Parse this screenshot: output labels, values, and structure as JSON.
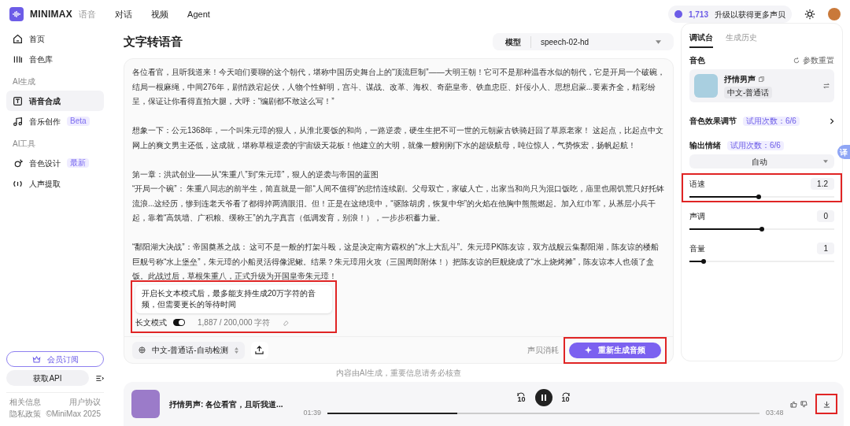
{
  "header": {
    "brand": "MINIMAX",
    "product": "语音",
    "nav": [
      {
        "label": "对话",
        "selected": false
      },
      {
        "label": "视频",
        "selected": false
      },
      {
        "label": "Agent",
        "selected": false
      }
    ],
    "credits": "1,713",
    "upgrade": "升级以获得更多声贝"
  },
  "sidebar": {
    "sections": [
      {
        "items": [
          {
            "label": "首页",
            "selected": false
          },
          {
            "label": "音色库",
            "selected": false
          }
        ]
      },
      {
        "title": "AI生成",
        "items": [
          {
            "label": "语音合成",
            "selected": true
          },
          {
            "label": "音乐创作",
            "badge": "Beta",
            "selected": false
          }
        ]
      },
      {
        "title": "AI工具",
        "items": [
          {
            "label": "音色设计",
            "badge": "最新",
            "selected": false
          },
          {
            "label": "人声提取",
            "selected": false
          }
        ]
      }
    ],
    "subscribe": "会员订阅",
    "api": "获取API",
    "footer": [
      [
        "相关信息",
        "用户协议"
      ],
      [
        "隐私政策",
        "©MiniMax 2025"
      ]
    ]
  },
  "page_title": "文字转语音",
  "model": {
    "label": "模型",
    "value": "speech-02-hd"
  },
  "editor": {
    "highlighted": true,
    "paragraphs": [
      {
        "text": "各位看官，且听我道来！今天咱们要聊的这个朝代，堪称中国历史舞台上的“顶流巨制”——大明王朝！它可不是那种温吞水似的朝代，它是开局一个破碗，结局一根麻绳，中间276年，剧情跌宕起伏，人物个性鲜明，宫斗、谋战、改革、海权、奇葩皇帝、铁血忠臣、奸佞小人、思想启蒙...要素齐全，精彩纷呈，保证让你看得直拍大腿，大呼：“编剧都不敢这么写！”",
        "blank_line_before": false
      },
      {
        "text": "想象一下：公元1368年，一个叫朱元璋的狠人，从淮北要饭的和尚，一路逆袭，硬生生把不可一世的元朝蒙古铁骑赶回了草原老家！ 这起点，比起点中文网上的爽文男主还低，这成就，堪称草根逆袭的宇宙级天花板！他建立的大明，就像一艘刚刚下水的超级航母，吨位惊人，气势恢宏，扬帆起航！",
        "blank_line_before": true
      },
      {
        "text": "第一章：洪武创业——从“朱重八”到“朱元璋”，狠人的逆袭与帝国的蓝图",
        "blank_line_before": true
      },
      {
        "text": "“开局一个碗”： 朱重八同志的前半生，简直就是一部“人间不值得”的悲情连续剧。父母双亡，家破人亡，出家当和尚只为混口饭吃，庙里也闹饥荒只好托钵流浪...这经历，惨到连老天爷看了都得掉两滴眼泪。但！正是在这绝境中，“驱除胡虏，恢复中华”的火焰在他胸中熊熊燃起。加入红巾军，从基层小兵干起，靠着“高筑墙、广积粮、缓称王”的九字真言（低调发育，别浪！），一步步积蓄力量。",
        "blank_line_before": false
      },
      {
        "text": "“鄱阳湖大决战”：帝国奠基之战： 这可不是一般的打架斗殴，这是决定南方霸权的“水上大乱斗”。朱元璋PK陈友谅，双方战舰云集鄱阳湖，陈友谅的楼船巨舰号称“水上堡垒”，朱元璋的小船灵活得像泥鳅。结果？朱元璋用火攻（三国周郎附体！）把陈友谅的巨舰烧成了“水上烧烤摊”，陈友谅本人也领了盒饭。此战过后，草根朱重八，正式升级为开国皇帝朱元璋！",
        "blank_line_before": true
      }
    ],
    "tooltip": "开启长文本模式后，最多能支持生成20万字符的音频，但需要更长的等待时间",
    "long_mode": {
      "label": "长文模式",
      "on": true
    },
    "count": "1,887 / 200,000 字符",
    "language": "中文-普通话-自动检测",
    "cost": "声贝消耗",
    "generate": {
      "label": "重新生成音频",
      "highlighted": true
    }
  },
  "disclaimer": "内容由AI生成，重要信息请务必核查",
  "panel": {
    "tabs": [
      {
        "label": "调试台",
        "selected": true
      },
      {
        "label": "生成历史",
        "selected": false
      }
    ],
    "voice_label": "音色",
    "reset": "参数重置",
    "voice": {
      "name": "抒情男声",
      "tag": "中文-普通话"
    },
    "effects": {
      "label": "音色效果调节",
      "badge": "试用次数：6/6"
    },
    "emotion": {
      "label": "输出情绪",
      "badge": "试用次数：6/6",
      "value": "自动"
    },
    "sliders": [
      {
        "label": "语速",
        "reading": "1.2",
        "level": 0.48,
        "highlighted": true
      },
      {
        "label": "声调",
        "reading": "0",
        "level": 0.5,
        "highlighted": false
      },
      {
        "label": "音量",
        "reading": "1",
        "level": 0.1,
        "highlighted": false
      }
    ]
  },
  "translate_button": "译",
  "player": {
    "title": "抒情男声: 各位看官，且听我道...",
    "back": "10",
    "forward": "10",
    "playing": true,
    "elapsed": "01:39",
    "level": 0.3,
    "total": "03:48",
    "download_highlighted": true
  }
}
